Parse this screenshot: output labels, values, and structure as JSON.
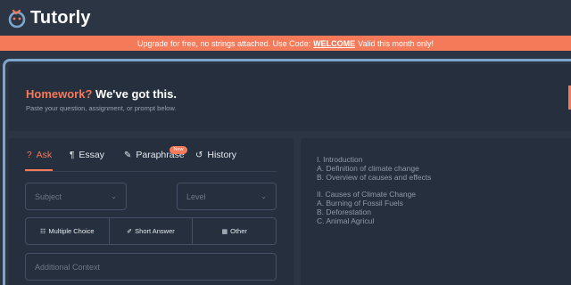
{
  "brand": {
    "name": "Tutorly"
  },
  "banner": {
    "prefix": "Upgrade for free, no strings attached. Use Code:",
    "code": "WELCOME",
    "suffix": "Valid this month only!"
  },
  "hero": {
    "title_accent": "Homework?",
    "title_rest": "We've got this.",
    "subtitle": "Paste your question, assignment, or prompt below."
  },
  "tabs": [
    {
      "label": "Ask",
      "icon": "question-icon",
      "active": true
    },
    {
      "label": "Essay",
      "icon": "pilcrow-icon"
    },
    {
      "label": "Paraphrase",
      "icon": "pencil-icon",
      "badge": "New"
    },
    {
      "label": "History",
      "icon": "history-icon"
    }
  ],
  "form": {
    "subject_placeholder": "Subject",
    "level_placeholder": "Level",
    "answer_types": [
      {
        "label": "Multiple Choice",
        "icon": "list-icon"
      },
      {
        "label": "Short Answer",
        "icon": "pen-icon"
      },
      {
        "label": "Other",
        "icon": "grid-icon"
      }
    ],
    "context_placeholder": "Additional Context"
  },
  "outline": [
    "I. Introduction",
    "A. Definition of climate change",
    "B. Overview of causes and effects",
    "II. Causes of Climate Change",
    "A. Burning of Fossil Fuels",
    "B. Deforestation",
    "C. Animal Agricul"
  ],
  "colors": {
    "accent": "#f47a5a",
    "background": "#2b3544",
    "panel": "#252f3e",
    "frame": "#7ea6cc"
  }
}
